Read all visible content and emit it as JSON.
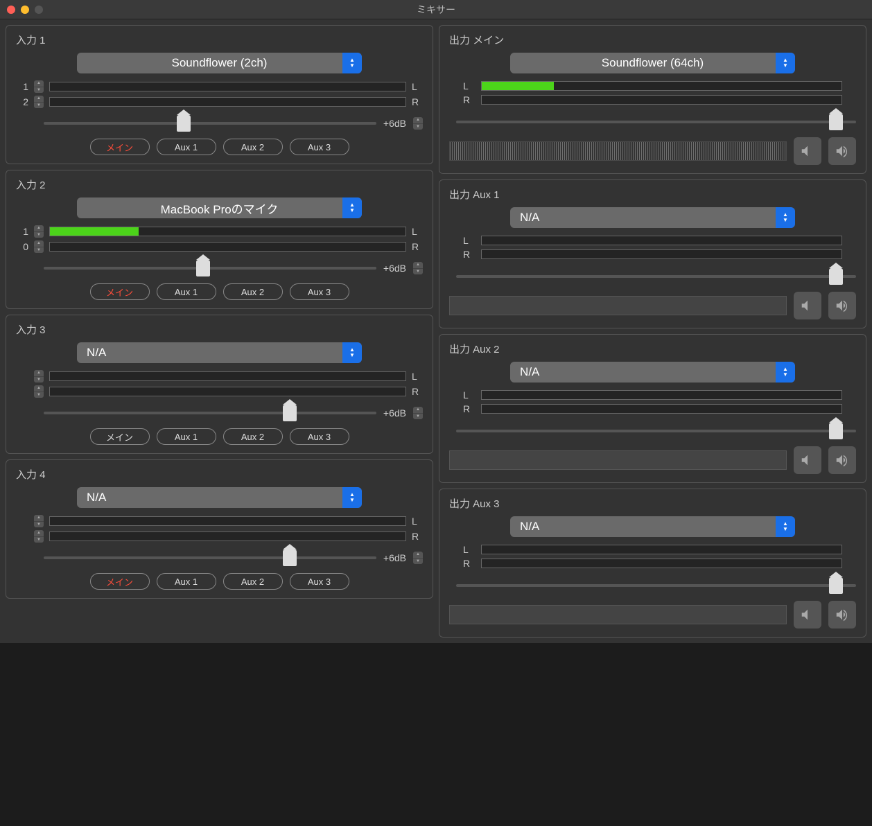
{
  "window": {
    "title": "ミキサー"
  },
  "labels": {
    "db6": "+6dB",
    "main": "メイン",
    "aux1": "Aux 1",
    "aux2": "Aux 2",
    "aux3": "Aux 3",
    "L": "L",
    "R": "R"
  },
  "inputs": [
    {
      "title": "入力 1",
      "device": "Soundflower (2ch)",
      "centered": true,
      "channels": [
        {
          "label": "1",
          "stepper": true,
          "fill": 0
        },
        {
          "label": "2",
          "stepper": true,
          "fill": 0
        }
      ],
      "sliderPos": 42,
      "mainActive": true
    },
    {
      "title": "入力 2",
      "device": "MacBook Proのマイク",
      "centered": true,
      "channels": [
        {
          "label": "1",
          "stepper": true,
          "fill": 25
        },
        {
          "label": "0",
          "stepper": true,
          "fill": 0
        }
      ],
      "sliderPos": 48,
      "mainActive": true
    },
    {
      "title": "入力 3",
      "device": "N/A",
      "centered": false,
      "channels": [
        {
          "label": "",
          "stepper": true,
          "fill": 0
        },
        {
          "label": "",
          "stepper": true,
          "fill": 0
        }
      ],
      "sliderPos": 74,
      "mainActive": false
    },
    {
      "title": "入力 4",
      "device": "N/A",
      "centered": false,
      "channels": [
        {
          "label": "",
          "stepper": true,
          "fill": 0
        },
        {
          "label": "",
          "stepper": true,
          "fill": 0
        }
      ],
      "sliderPos": 74,
      "mainActive": true
    }
  ],
  "outputs": [
    {
      "title": "出力 メイン",
      "device": "Soundflower (64ch)",
      "centered": true,
      "meters": {
        "L": 20,
        "R": 0
      },
      "sliderPos": 95,
      "vuDim": false
    },
    {
      "title": "出力 Aux 1",
      "device": "N/A",
      "centered": false,
      "meters": {
        "L": 0,
        "R": 0
      },
      "sliderPos": 95,
      "vuDim": true
    },
    {
      "title": "出力 Aux 2",
      "device": "N/A",
      "centered": false,
      "meters": {
        "L": 0,
        "R": 0
      },
      "sliderPos": 95,
      "vuDim": true
    },
    {
      "title": "出力 Aux 3",
      "device": "N/A",
      "centered": false,
      "meters": {
        "L": 0,
        "R": 0
      },
      "sliderPos": 95,
      "vuDim": true
    }
  ]
}
